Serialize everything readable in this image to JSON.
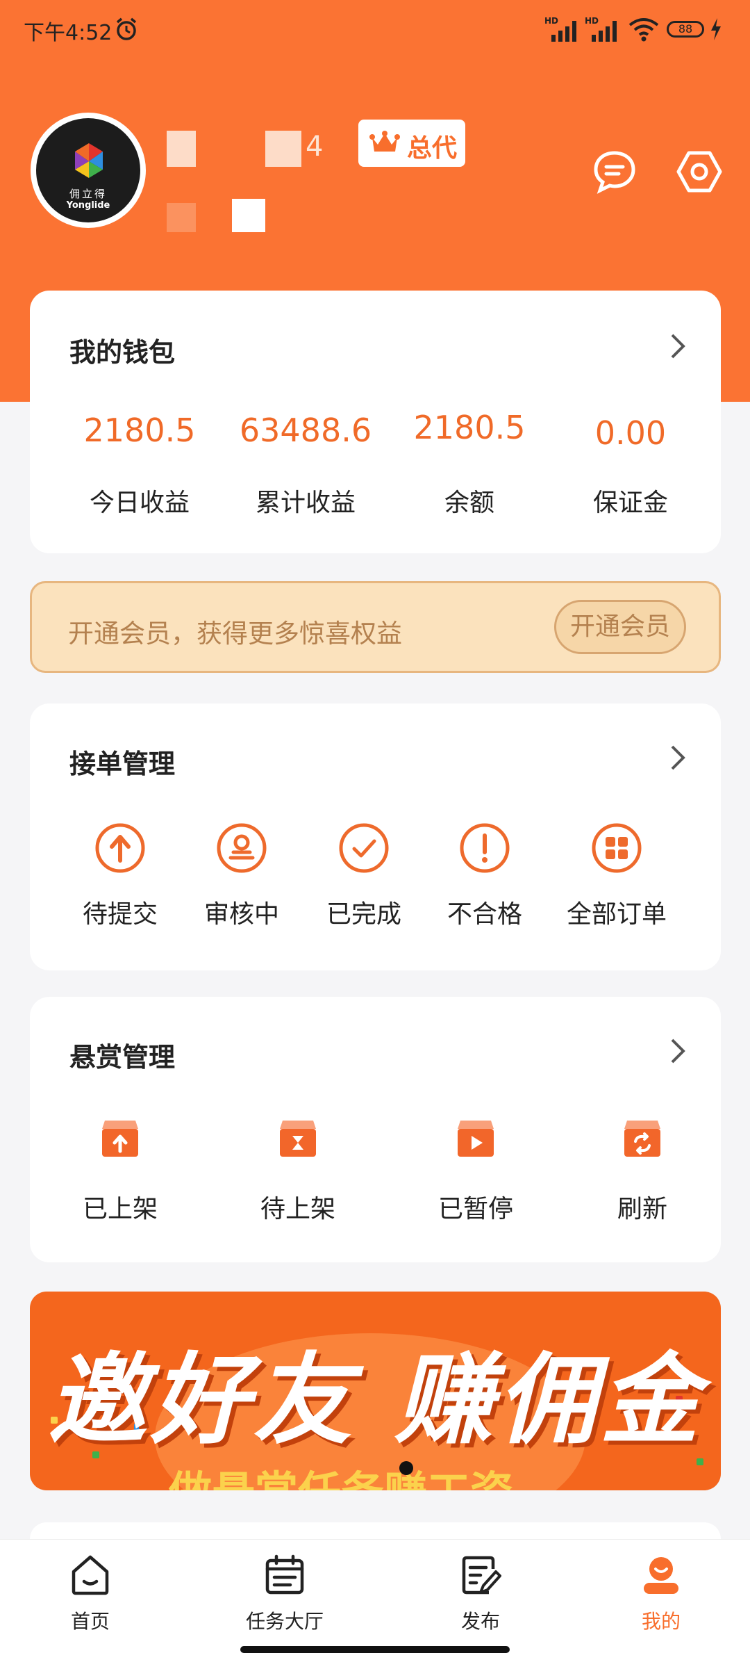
{
  "status_bar": {
    "time": "下午4:52",
    "battery": "88"
  },
  "profile": {
    "avatar_brand_cn": "佣立得",
    "avatar_brand_en": "Yonglide",
    "name_visible_fragment": "4",
    "role_badge": "总代"
  },
  "header_actions": {
    "message_icon": "message-icon",
    "settings_icon": "settings-icon"
  },
  "wallet": {
    "title": "我的钱包",
    "stats": [
      {
        "value": "2180.5",
        "label": "今日收益"
      },
      {
        "value": "63488.6",
        "label": "累计收益"
      },
      {
        "value": "2180.5",
        "label": "余额"
      },
      {
        "value": "0.00",
        "label": "保证金"
      }
    ]
  },
  "vip": {
    "text": "开通会员，获得更多惊喜权益",
    "button": "开通会员"
  },
  "orders": {
    "title": "接单管理",
    "items": [
      {
        "label": "待提交",
        "icon": "upload-circle-icon"
      },
      {
        "label": "审核中",
        "icon": "reviewer-icon"
      },
      {
        "label": "已完成",
        "icon": "check-circle-icon"
      },
      {
        "label": "不合格",
        "icon": "exclamation-circle-icon"
      },
      {
        "label": "全部订单",
        "icon": "grid-icon"
      }
    ]
  },
  "bounty": {
    "title": "悬赏管理",
    "items": [
      {
        "label": "已上架",
        "icon": "box-up-icon"
      },
      {
        "label": "待上架",
        "icon": "box-hourglass-icon"
      },
      {
        "label": "已暂停",
        "icon": "box-play-icon"
      },
      {
        "label": "刷新",
        "icon": "box-refresh-icon"
      }
    ]
  },
  "banner": {
    "title": "邀好友 赚佣金",
    "subtitle": "做悬赏任务赚工资"
  },
  "colors": {
    "brand": "#fb7333",
    "accent_text": "#f06a28",
    "vip_bg": "#fbe2bd"
  },
  "tabbar": {
    "items": [
      {
        "label": "首页",
        "icon": "home-icon",
        "active": false
      },
      {
        "label": "任务大厅",
        "icon": "calendar-icon",
        "active": false
      },
      {
        "label": "发布",
        "icon": "edit-note-icon",
        "active": false
      },
      {
        "label": "我的",
        "icon": "user-icon",
        "active": true
      }
    ]
  }
}
